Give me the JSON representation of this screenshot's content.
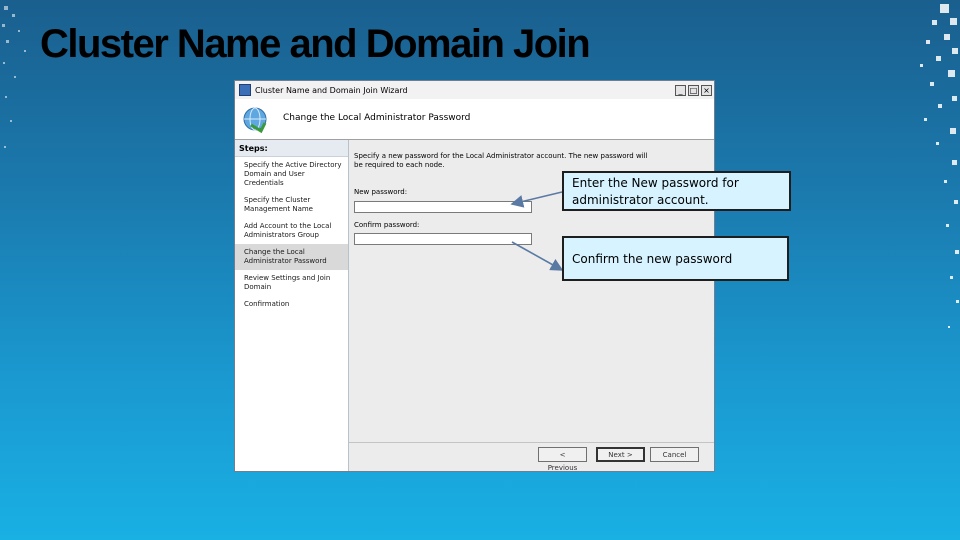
{
  "slide": {
    "title": "Cluster Name and Domain Join"
  },
  "window": {
    "title": "Cluster Name and Domain Join Wizard",
    "controls": {
      "minimize": "_",
      "maximize": "□",
      "close": "×"
    }
  },
  "header": {
    "title": "Change the Local Administrator Password",
    "icon": "wizard-icon"
  },
  "steps": {
    "heading": "Steps:",
    "items": [
      {
        "label": "Specify the Active Directory Domain and User Credentials"
      },
      {
        "label": "Specify the Cluster Management Name"
      },
      {
        "label": "Add Account to the Local Administrators Group"
      },
      {
        "label": "Change the Local Administrator Password"
      },
      {
        "label": "Review Settings and Join Domain"
      },
      {
        "label": "Confirmation"
      }
    ]
  },
  "content": {
    "intro": "Specify a new password for the Local Administrator account. The new password will be required to each node.",
    "new_password_label": "New password:",
    "confirm_password_label": "Confirm password:",
    "new_password_value": "",
    "confirm_password_value": ""
  },
  "buttons": {
    "previous": "< Previous",
    "next": "Next >",
    "cancel": "Cancel"
  },
  "callouts": {
    "new_password": "Enter the New password for administrator account.",
    "confirm_password": "Confirm the new password"
  },
  "colors": {
    "callout_bg": "#d6f3ff",
    "background_top": "#1a5f8e",
    "background_bottom": "#19b0e4"
  }
}
